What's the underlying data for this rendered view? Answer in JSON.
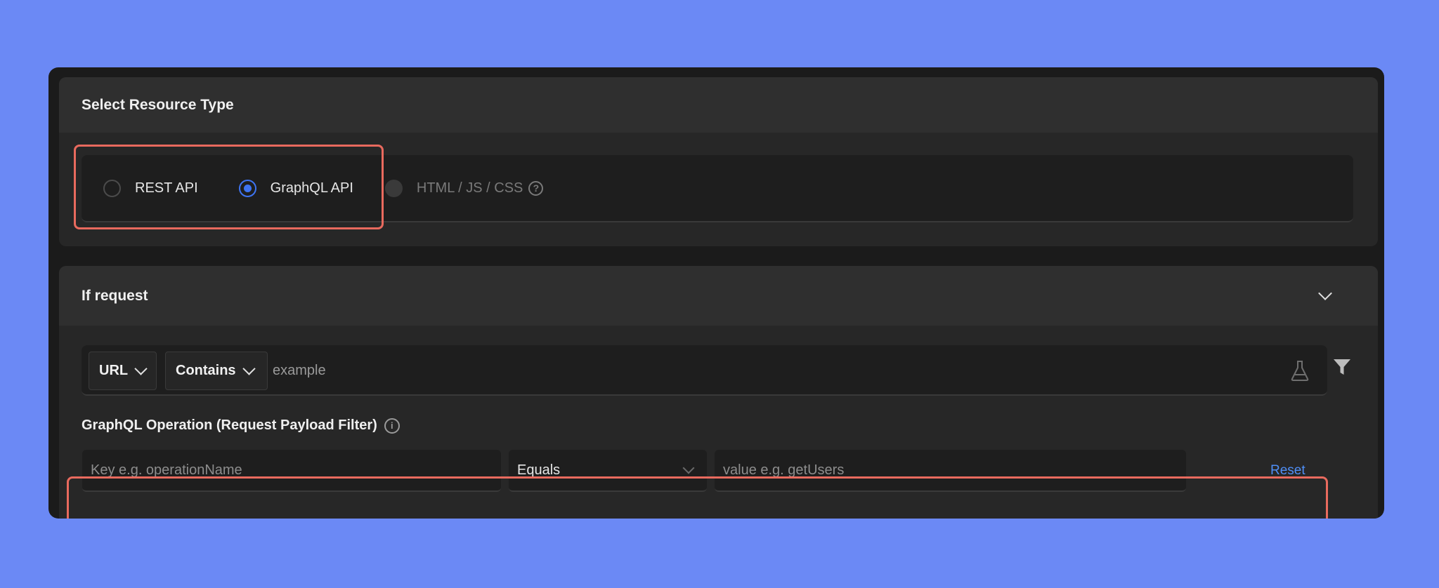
{
  "resource_type": {
    "title": "Select Resource Type",
    "options": [
      {
        "label": "REST API",
        "checked": false,
        "disabled": false
      },
      {
        "label": "GraphQL API",
        "checked": true,
        "disabled": false
      },
      {
        "label": "HTML / JS / CSS",
        "checked": false,
        "disabled": true
      }
    ],
    "help_icon": "question-circle-icon"
  },
  "if_request": {
    "title": "If request",
    "collapse_icon": "chevron-down-icon",
    "source_field": "URL",
    "operator": "Contains",
    "value": "example",
    "test_icon": "flask-icon",
    "filter_icon": "filter-icon"
  },
  "graphql_filter": {
    "title": "GraphQL Operation (Request Payload Filter)",
    "info_icon": "info-circle-icon",
    "key_placeholder": "Key e.g. operationName",
    "operator": "Equals",
    "value_placeholder": "value e.g. getUsers",
    "reset_label": "Reset"
  },
  "colors": {
    "background": "#6b89f5",
    "accent": "#3e74f2",
    "highlight": "#e96a5e",
    "link": "#4f8ff7"
  }
}
